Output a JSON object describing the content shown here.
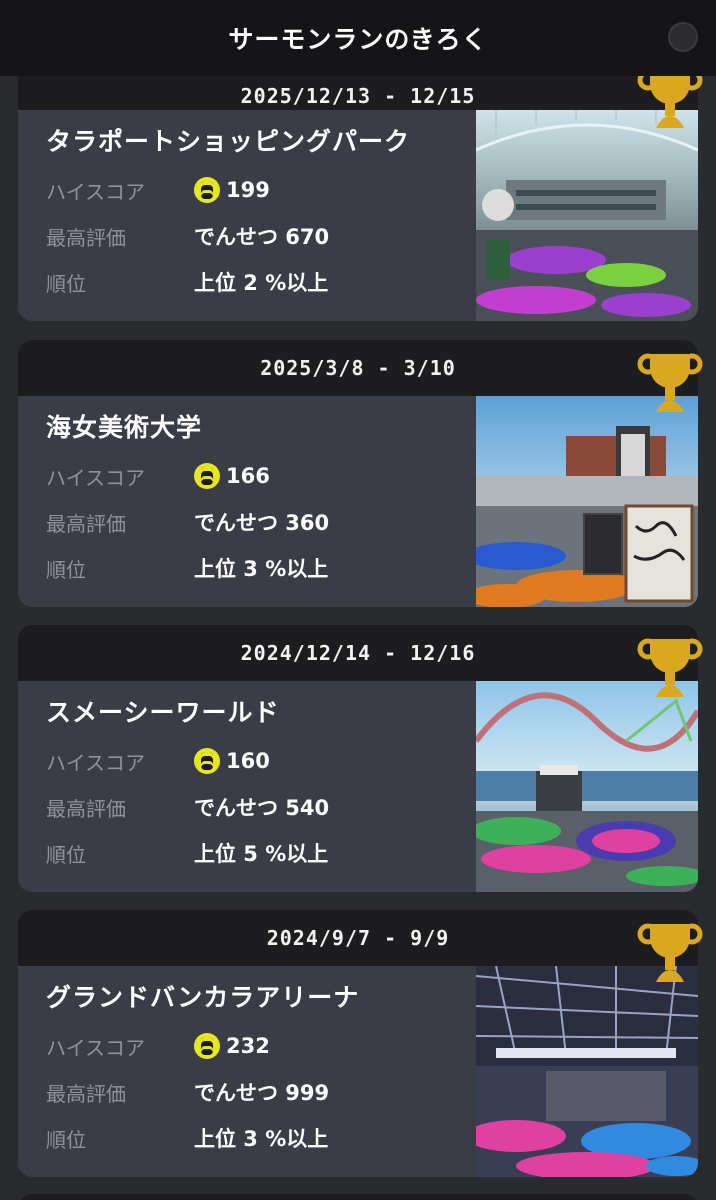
{
  "header": {
    "title": "サーモンランのきろく"
  },
  "labels": {
    "high_score": "ハイスコア",
    "best_rating": "最高評価",
    "rank": "順位"
  },
  "cards": [
    {
      "date": "2025/12/13 - 12/15",
      "stage": "タラポートショッピングパーク",
      "high_score": "199",
      "best_rating": "でんせつ 670",
      "rank": "上位 2 %以上"
    },
    {
      "date": "2025/3/8 - 3/10",
      "stage": "海女美術大学",
      "high_score": "166",
      "best_rating": "でんせつ 360",
      "rank": "上位 3 %以上"
    },
    {
      "date": "2024/12/14 - 12/16",
      "stage": "スメーシーワールド",
      "high_score": "160",
      "best_rating": "でんせつ 540",
      "rank": "上位 5 %以上"
    },
    {
      "date": "2024/9/7 - 9/9",
      "stage": "グランドバンカラアリーナ",
      "high_score": "232",
      "best_rating": "でんせつ 999",
      "rank": "上位 3 %以上"
    }
  ],
  "colors": {
    "trophy": "#d9a820",
    "egg": "#e8e620",
    "card_bg": "#3a3d46",
    "date_bar": "#1d1d20"
  }
}
